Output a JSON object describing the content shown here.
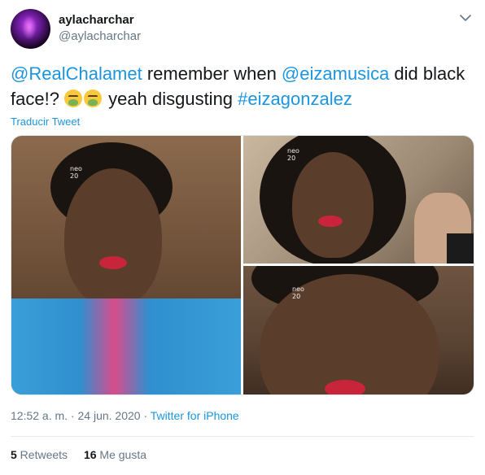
{
  "user": {
    "display_name": "aylacharchar",
    "handle": "@aylacharchar"
  },
  "menu_icon": "chevron-down-icon",
  "tweet": {
    "mention1": "@RealChalamet",
    "text1": " remember when ",
    "mention2": "@eizamusica",
    "text2": " did black face!? ",
    "emoji_name": "nauseated-face-icon",
    "text3": " yeah disgusting ",
    "hashtag": "#eizagonzalez"
  },
  "translate_label": "Traducir Tweet",
  "media": {
    "watermark_line1": "neo",
    "watermark_line2": "20"
  },
  "meta": {
    "time": "12:52 a. m.",
    "separator": " · ",
    "date": "24 jun. 2020",
    "source": "Twitter for iPhone"
  },
  "stats": {
    "retweets_count": "5",
    "retweets_label": " Retweets",
    "likes_count": "16",
    "likes_label": " Me gusta"
  },
  "colors": {
    "link": "#1b95e0",
    "secondary_text": "#657786",
    "primary_text": "#14171a"
  }
}
